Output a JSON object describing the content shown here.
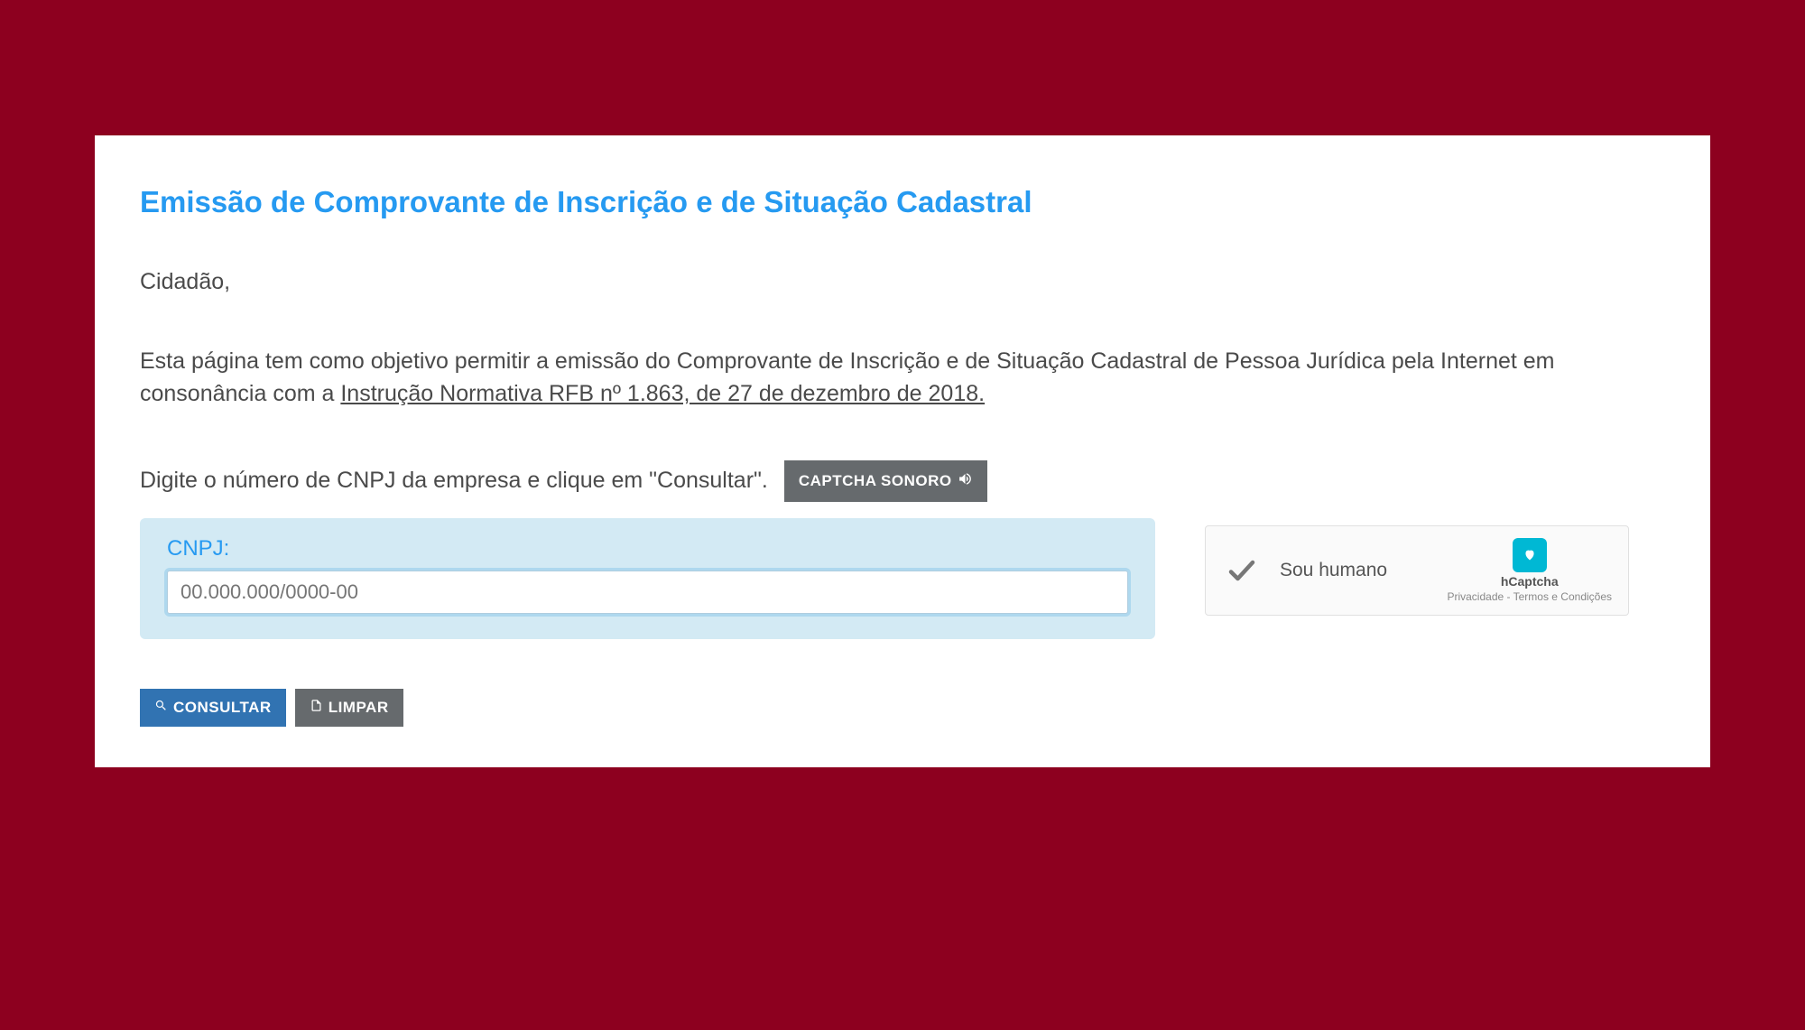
{
  "title": "Emissão de Comprovante de Inscrição e de Situação Cadastral",
  "salutation": "Cidadão,",
  "description_before_link": "Esta página tem como objetivo permitir a emissão do Comprovante de Inscrição e de Situação Cadastral de Pessoa Jurídica pela Internet em consonância com a ",
  "description_link": "Instrução Normativa RFB nº 1.863, de 27 de dezembro de 2018.",
  "instruction": "Digite o número de CNPJ da empresa e clique em \"Consultar\".",
  "captcha_sonoro_label": "CAPTCHA SONORO",
  "cnpj_label": "CNPJ:",
  "cnpj_placeholder": "00.000.000/0000-00",
  "cnpj_value": "",
  "hcaptcha": {
    "label": "Sou humano",
    "brand": "hCaptcha",
    "terms": "Privacidade - Termos e Condições"
  },
  "buttons": {
    "consultar": "CONSULTAR",
    "limpar": "LIMPAR"
  }
}
